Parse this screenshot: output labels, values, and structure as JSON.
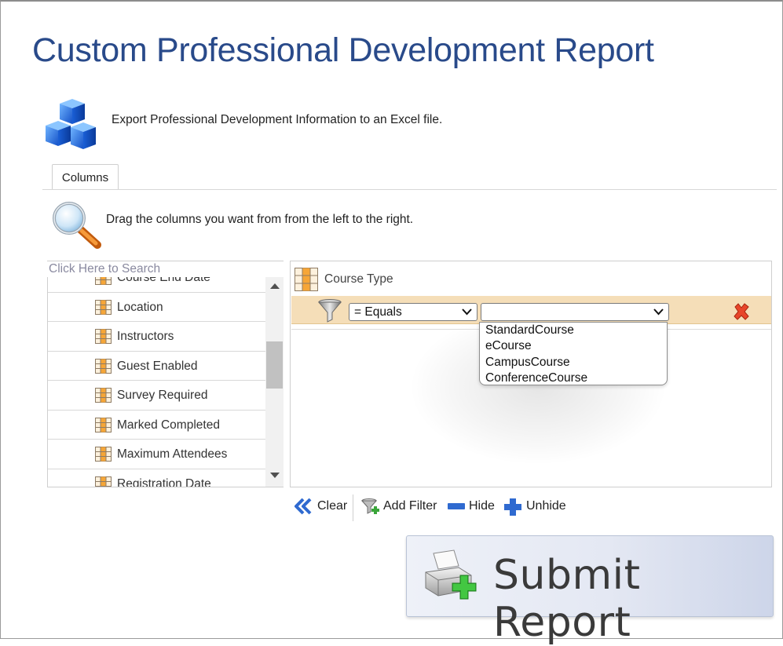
{
  "page": {
    "title": "Custom Professional Development Report",
    "intro": "Export Professional Development Information to an Excel file.",
    "instructions": "Drag the columns you want from from the left to the right."
  },
  "tabs": [
    {
      "label": "Columns",
      "active": true
    }
  ],
  "columns_list": {
    "search_placeholder": "Click Here to Search",
    "items": [
      {
        "label": "Course End Date"
      },
      {
        "label": "Location"
      },
      {
        "label": "Instructors"
      },
      {
        "label": "Guest Enabled"
      },
      {
        "label": "Survey Required"
      },
      {
        "label": "Marked Completed"
      },
      {
        "label": "Maximum Attendees"
      },
      {
        "label": "Registration Date"
      }
    ]
  },
  "selected_columns": {
    "column_label": "Course Type",
    "filter": {
      "operator": "= Equals",
      "value": "",
      "value_options": [
        "StandardCourse",
        "eCourse",
        "CampusCourse",
        "ConferenceCourse"
      ]
    }
  },
  "toolbar": {
    "clear": "Clear",
    "add_filter": "Add Filter",
    "hide": "Hide",
    "unhide": "Unhide"
  },
  "submit": {
    "label": "Submit Report"
  },
  "colors": {
    "title": "#294a8a",
    "filter_row": "#f5deb8",
    "delete_icon": "#e8462a",
    "toolbar_icon": "#2f6ad0"
  }
}
